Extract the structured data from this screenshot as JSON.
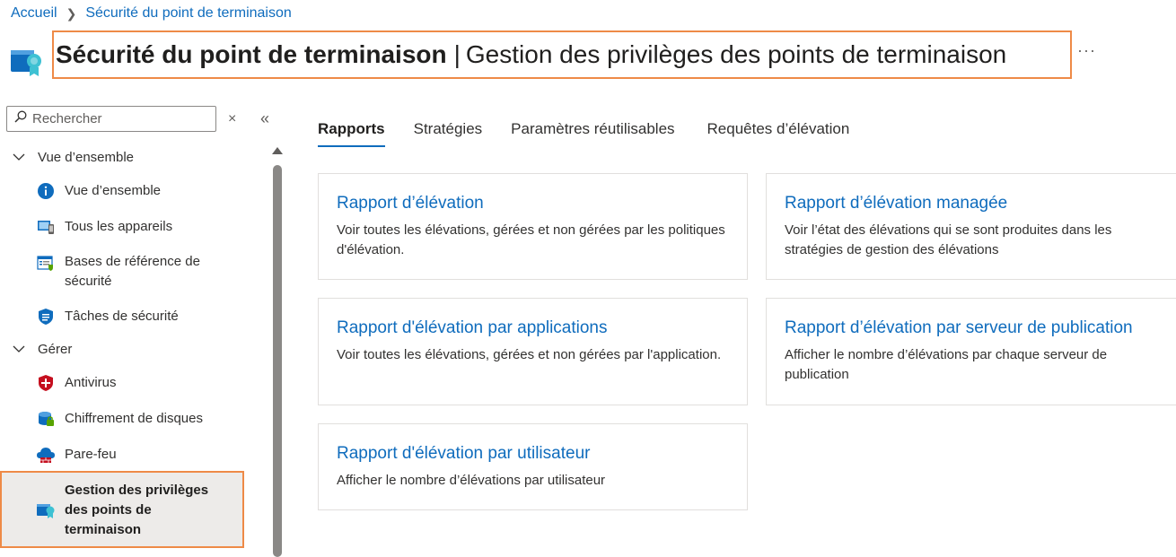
{
  "breadcrumb": {
    "home": "Accueil",
    "current": "Sécurité du point de terminaison"
  },
  "header": {
    "title": "Sécurité du point de terminaison",
    "separator": "|",
    "subtitle": "Gestion des privilèges des points de terminaison",
    "more": "···"
  },
  "sidebar": {
    "search_placeholder": "Rechercher",
    "clear": "×",
    "collapse": "«",
    "groups": [
      {
        "label": "Vue d’ensemble",
        "items": [
          {
            "label": "Vue d’ensemble",
            "icon": "info-icon"
          },
          {
            "label": "Tous les appareils",
            "icon": "devices-icon"
          },
          {
            "label": "Bases de référence de sécurité",
            "icon": "security-baseline-icon"
          },
          {
            "label": "Tâches de sécurité",
            "icon": "security-tasks-icon"
          }
        ]
      },
      {
        "label": "Gérer",
        "items": [
          {
            "label": "Antivirus",
            "icon": "antivirus-shield-icon"
          },
          {
            "label": "Chiffrement de disques",
            "icon": "disk-encryption-icon"
          },
          {
            "label": "Pare-feu",
            "icon": "firewall-icon"
          },
          {
            "label": "Gestion des privilèges des points de terminaison",
            "icon": "privilege-management-icon"
          }
        ]
      }
    ]
  },
  "tabs": [
    "Rapports",
    "Stratégies",
    "Paramètres réutilisables",
    "Requêtes d’élévation"
  ],
  "cards": [
    {
      "title": "Rapport d’élévation",
      "desc": "Voir toutes les élévations, gérées et non gérées par les politiques d'élévation."
    },
    {
      "title": "Rapport d’élévation managée",
      "desc": "Voir l’état des élévations qui se sont produites dans les stratégies de gestion des élévations"
    },
    {
      "title": "Rapport d'élévation par applications",
      "desc": "Voir toutes les élévations, gérées et non gérées par l'application."
    },
    {
      "title": "Rapport d’élévation par serveur de publication",
      "desc": "Afficher le nombre d’élévations par chaque serveur de publication"
    },
    {
      "title": "Rapport d'élévation par utilisateur",
      "desc": "Afficher le nombre d’élévations par utilisateur"
    }
  ],
  "colors": {
    "accent": "#0f6cbd",
    "highlight": "#ee8a47",
    "selected_bg": "#edebe9"
  }
}
